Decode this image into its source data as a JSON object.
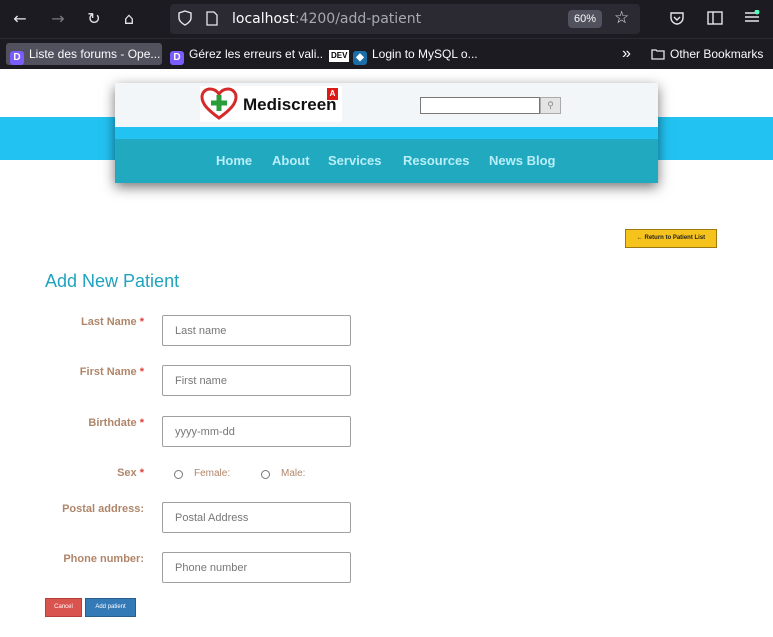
{
  "browser": {
    "url_host": "localhost",
    "url_path": ":4200/add-patient",
    "zoom": "60%",
    "icons": {
      "back": "arrow-left",
      "forward": "arrow-right",
      "reload": "reload",
      "home": "home",
      "shield": "shield",
      "page": "page",
      "star": "star",
      "pocket": "pocket",
      "reader": "reader",
      "menu": "menu"
    }
  },
  "bookmarks": {
    "items": [
      {
        "label": "Liste des forums - Ope..."
      },
      {
        "label": "Gérez les erreurs et vali..."
      },
      {
        "label": "DEV"
      },
      {
        "label": "Login to MySQL o..."
      }
    ],
    "other_label": "Other Bookmarks",
    "overflow_label": "»"
  },
  "header": {
    "brand": "Mediscreen",
    "angular_badge": "A",
    "search_value": "",
    "nav": [
      "Home",
      "About",
      "Services",
      "Resources",
      "News Blog"
    ]
  },
  "page": {
    "return_button": "← Return to Patient List",
    "title": "Add New Patient",
    "required_marker": "*",
    "fields": {
      "last_name": {
        "label": "Last Name",
        "placeholder": "Last name"
      },
      "first_name": {
        "label": "First Name",
        "placeholder": "First name"
      },
      "birthdate": {
        "label": "Birthdate",
        "placeholder": "yyyy-mm-dd"
      },
      "sex": {
        "label": "Sex",
        "female": "Female:",
        "male": "Male:"
      },
      "postal": {
        "label": "Postal address:",
        "placeholder": "Postal Address"
      },
      "phone": {
        "label": "Phone number:",
        "placeholder": "Phone number"
      }
    },
    "cancel_button": "Cancel",
    "add_button": "Add patient"
  },
  "colors": {
    "accent": "#1fa3bf",
    "band": "#22c3f3",
    "nav": "#21a9bf",
    "warning": "#f6c21c",
    "danger": "#d9534f",
    "primary": "#337ab7"
  }
}
